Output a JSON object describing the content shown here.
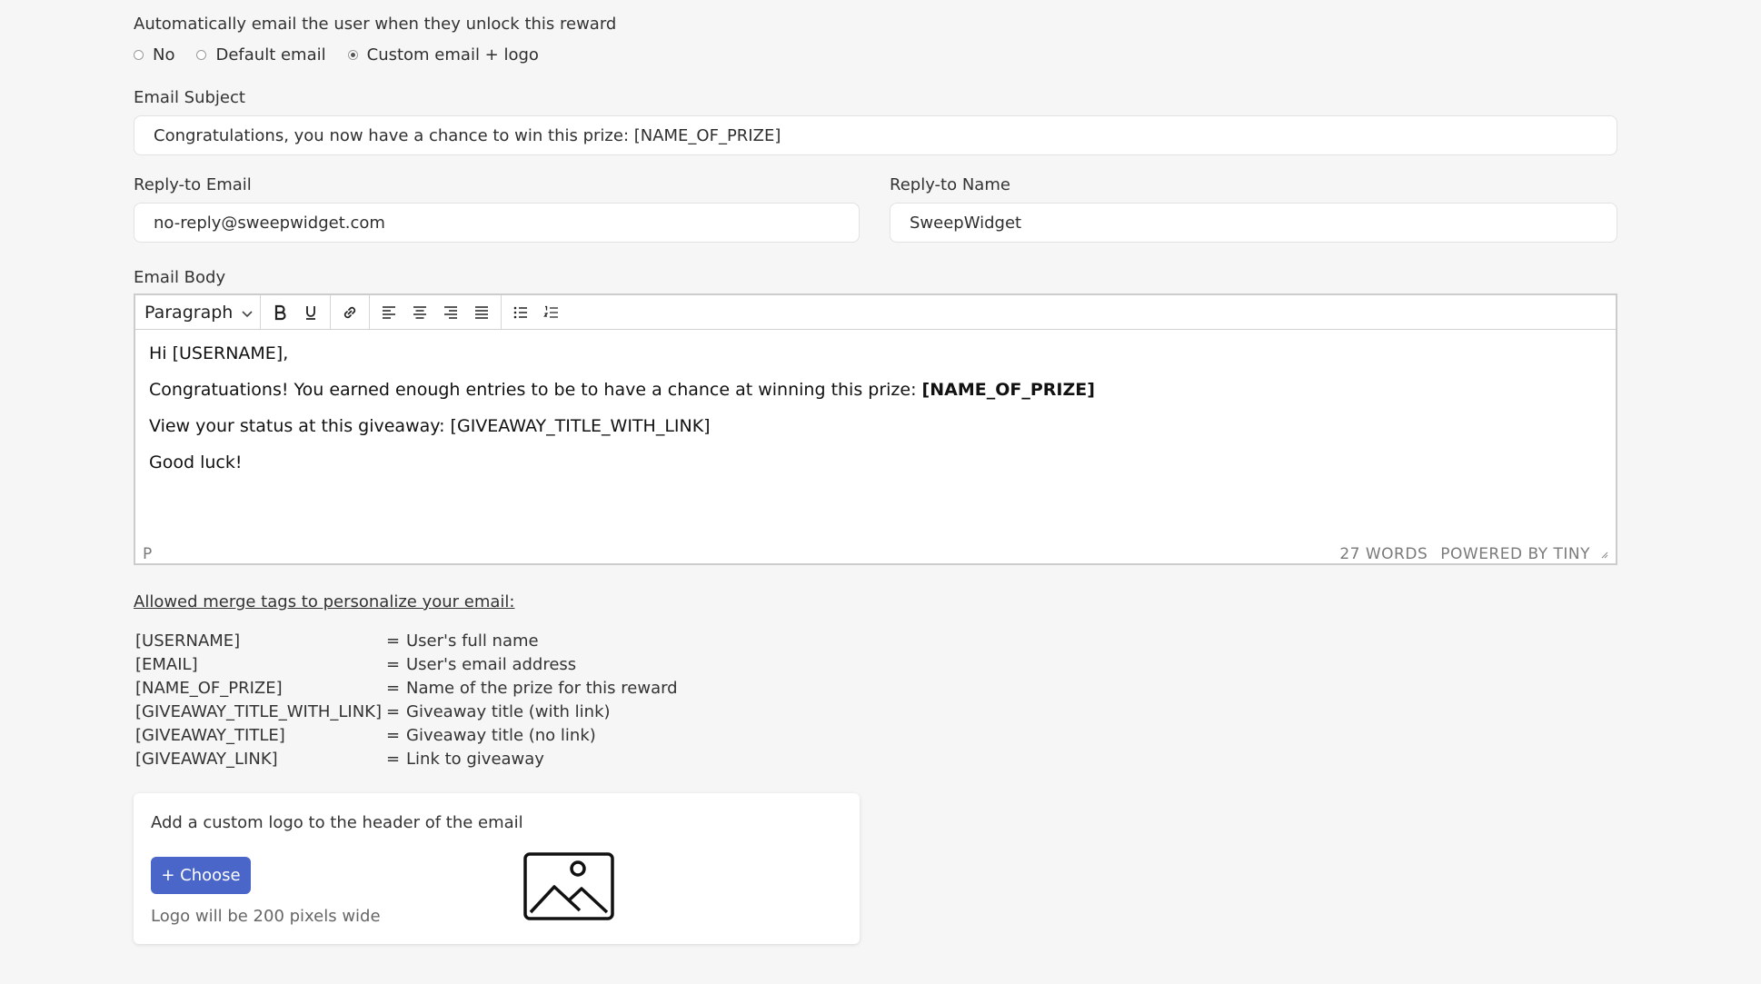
{
  "auto_email": {
    "label": "Automatically email the user when they unlock this reward",
    "options": [
      {
        "label": "No",
        "selected": false
      },
      {
        "label": "Default email",
        "selected": false
      },
      {
        "label": "Custom email + logo",
        "selected": true
      }
    ]
  },
  "subject": {
    "label": "Email Subject",
    "value": "Congratulations, you now have a chance to win this prize: [NAME_OF_PRIZE]"
  },
  "reply_email": {
    "label": "Reply-to Email",
    "value": "no-reply@sweepwidget.com"
  },
  "reply_name": {
    "label": "Reply-to Name",
    "value": "SweepWidget"
  },
  "body": {
    "label": "Email Body",
    "format_select": "Paragraph",
    "lines": {
      "greeting": "Hi [USERNAME],",
      "congrats": "Congratuations! You earned enough entries to be to have a chance at winning this prize: ",
      "congrats_bold": "[NAME_OF_PRIZE]",
      "status": "View your status at this giveaway: [GIVEAWAY_TITLE_WITH_LINK]",
      "closing": "Good luck!"
    },
    "status_path": "P",
    "word_count": "27 WORDS",
    "powered_by": "POWERED BY TINY"
  },
  "merge": {
    "title": "Allowed merge tags to personalize your email:",
    "rows": [
      {
        "tag": "[USERNAME]",
        "eq": "=",
        "desc": "User's full name"
      },
      {
        "tag": "[EMAIL]",
        "eq": "=",
        "desc": "User's email address"
      },
      {
        "tag": "[NAME_OF_PRIZE]",
        "eq": "=",
        "desc": "Name of the prize for this reward"
      },
      {
        "tag": "[GIVEAWAY_TITLE_WITH_LINK]",
        "eq": "=",
        "desc": "Giveaway title (with link)"
      },
      {
        "tag": "[GIVEAWAY_TITLE]",
        "eq": "=",
        "desc": "Giveaway title (no link)"
      },
      {
        "tag": "[GIVEAWAY_LINK]",
        "eq": "=",
        "desc": "Link to giveaway"
      }
    ]
  },
  "logo": {
    "title": "Add a custom logo to the header of the email",
    "button": "+ Choose",
    "hint": "Logo will be 200 pixels wide",
    "icon": "image-placeholder-icon"
  },
  "colors": {
    "accent": "#4a66c8",
    "background": "#f6f6f6"
  }
}
